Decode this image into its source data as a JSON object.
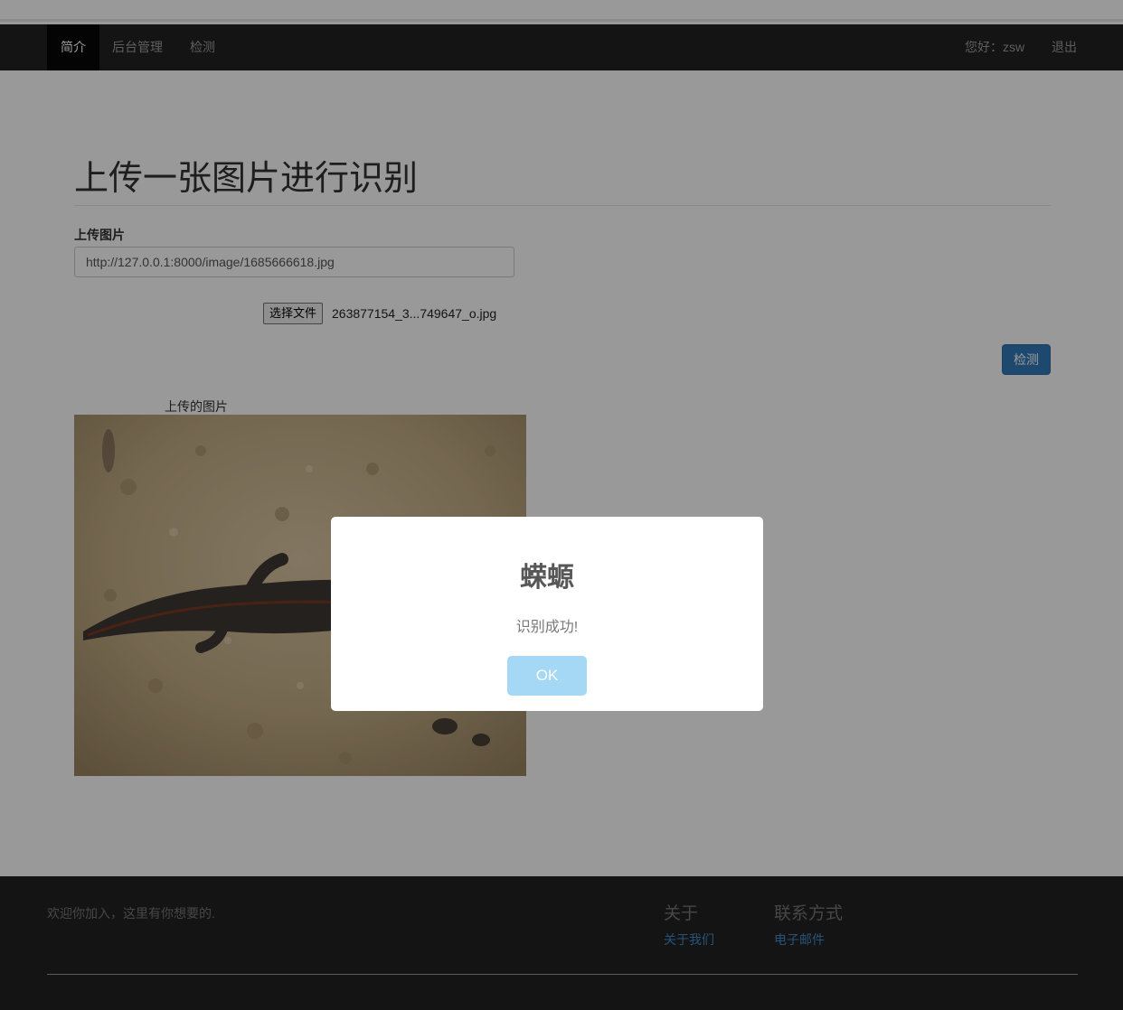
{
  "nav": {
    "items": [
      {
        "label": "简介",
        "active": true
      },
      {
        "label": "后台管理",
        "active": false
      },
      {
        "label": "检测",
        "active": false
      }
    ],
    "greeting": "您好：zsw",
    "logout": "退出"
  },
  "main": {
    "title": "上传一张图片进行识别",
    "upload_label": "上传图片",
    "url_value": "http://127.0.0.1:8000/image/1685666618.jpg",
    "file_button": "选择文件",
    "file_name": "263877154_3...749647_o.jpg",
    "detect_button": "检测",
    "image_caption": "上传的图片",
    "image_icon": "salamander-photo"
  },
  "footer": {
    "tagline": "欢迎你加入，这里有你想要的.",
    "about_heading": "关于",
    "about_link": "关于我们",
    "contact_heading": "联系方式",
    "contact_link": "电子邮件"
  },
  "modal": {
    "title": "蝾螈",
    "message": "识别成功!",
    "ok": "OK"
  },
  "colors": {
    "navbar": "#222222",
    "primary": "#337ab7",
    "ok_button": "#a5d8f5",
    "link": "#428bca"
  }
}
